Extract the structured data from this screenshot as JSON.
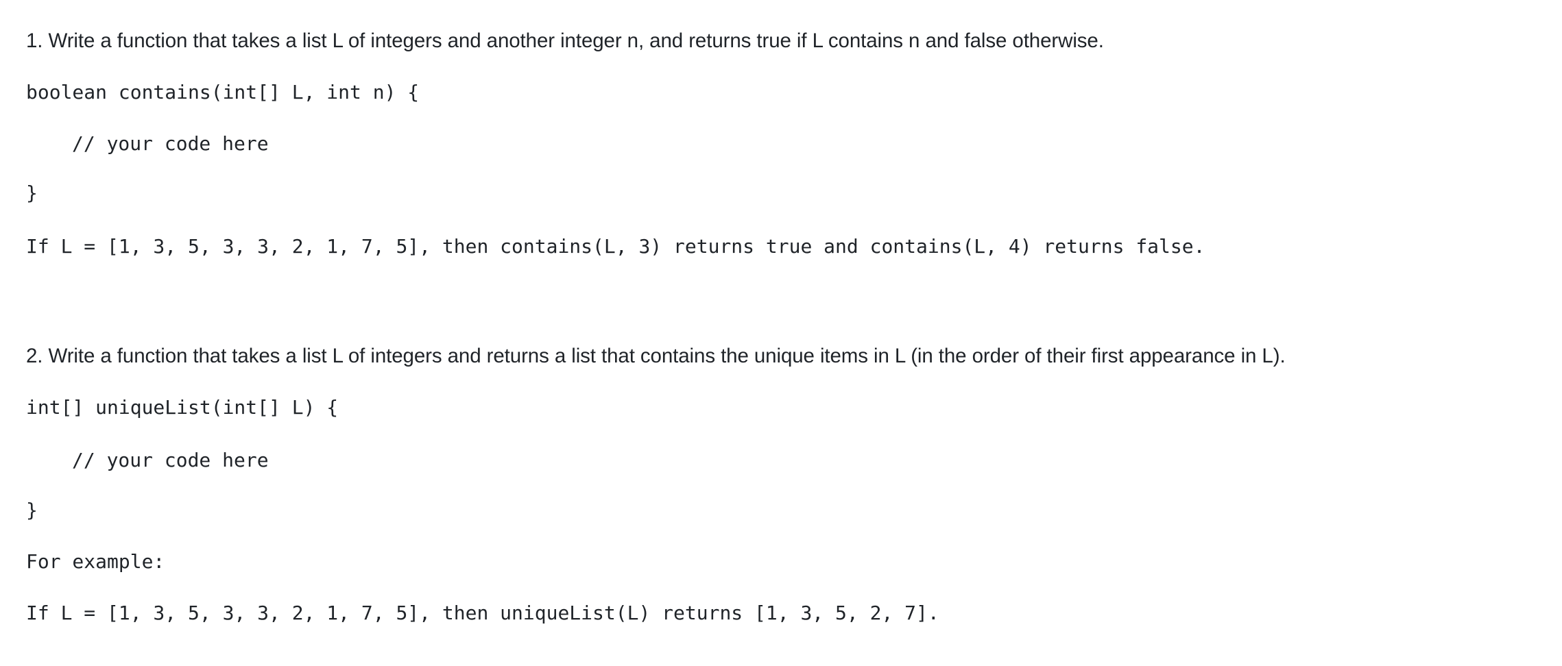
{
  "questions": [
    {
      "prompt": "1. Write a function that takes a list L of integers and another integer n, and returns true if L contains n and false otherwise.",
      "signature": "boolean contains(int[] L, int n) {",
      "body_comment": "// your code here",
      "closing_brace": "}",
      "example_intro": null,
      "example": "If L = [1, 3, 5, 3, 3, 2, 1, 7, 5], then contains(L, 3) returns true and contains(L, 4) returns false."
    },
    {
      "prompt": "2. Write a function that takes a list L of integers and returns a list that contains the unique items in L (in the order of their first appearance in L).",
      "signature": "int[] uniqueList(int[] L) {",
      "body_comment": "// your code here",
      "closing_brace": "}",
      "example_intro": "For example:",
      "example": "If L = [1, 3, 5, 3, 3, 2, 1, 7, 5], then uniqueList(L) returns [1, 3, 5, 2, 7]."
    }
  ]
}
